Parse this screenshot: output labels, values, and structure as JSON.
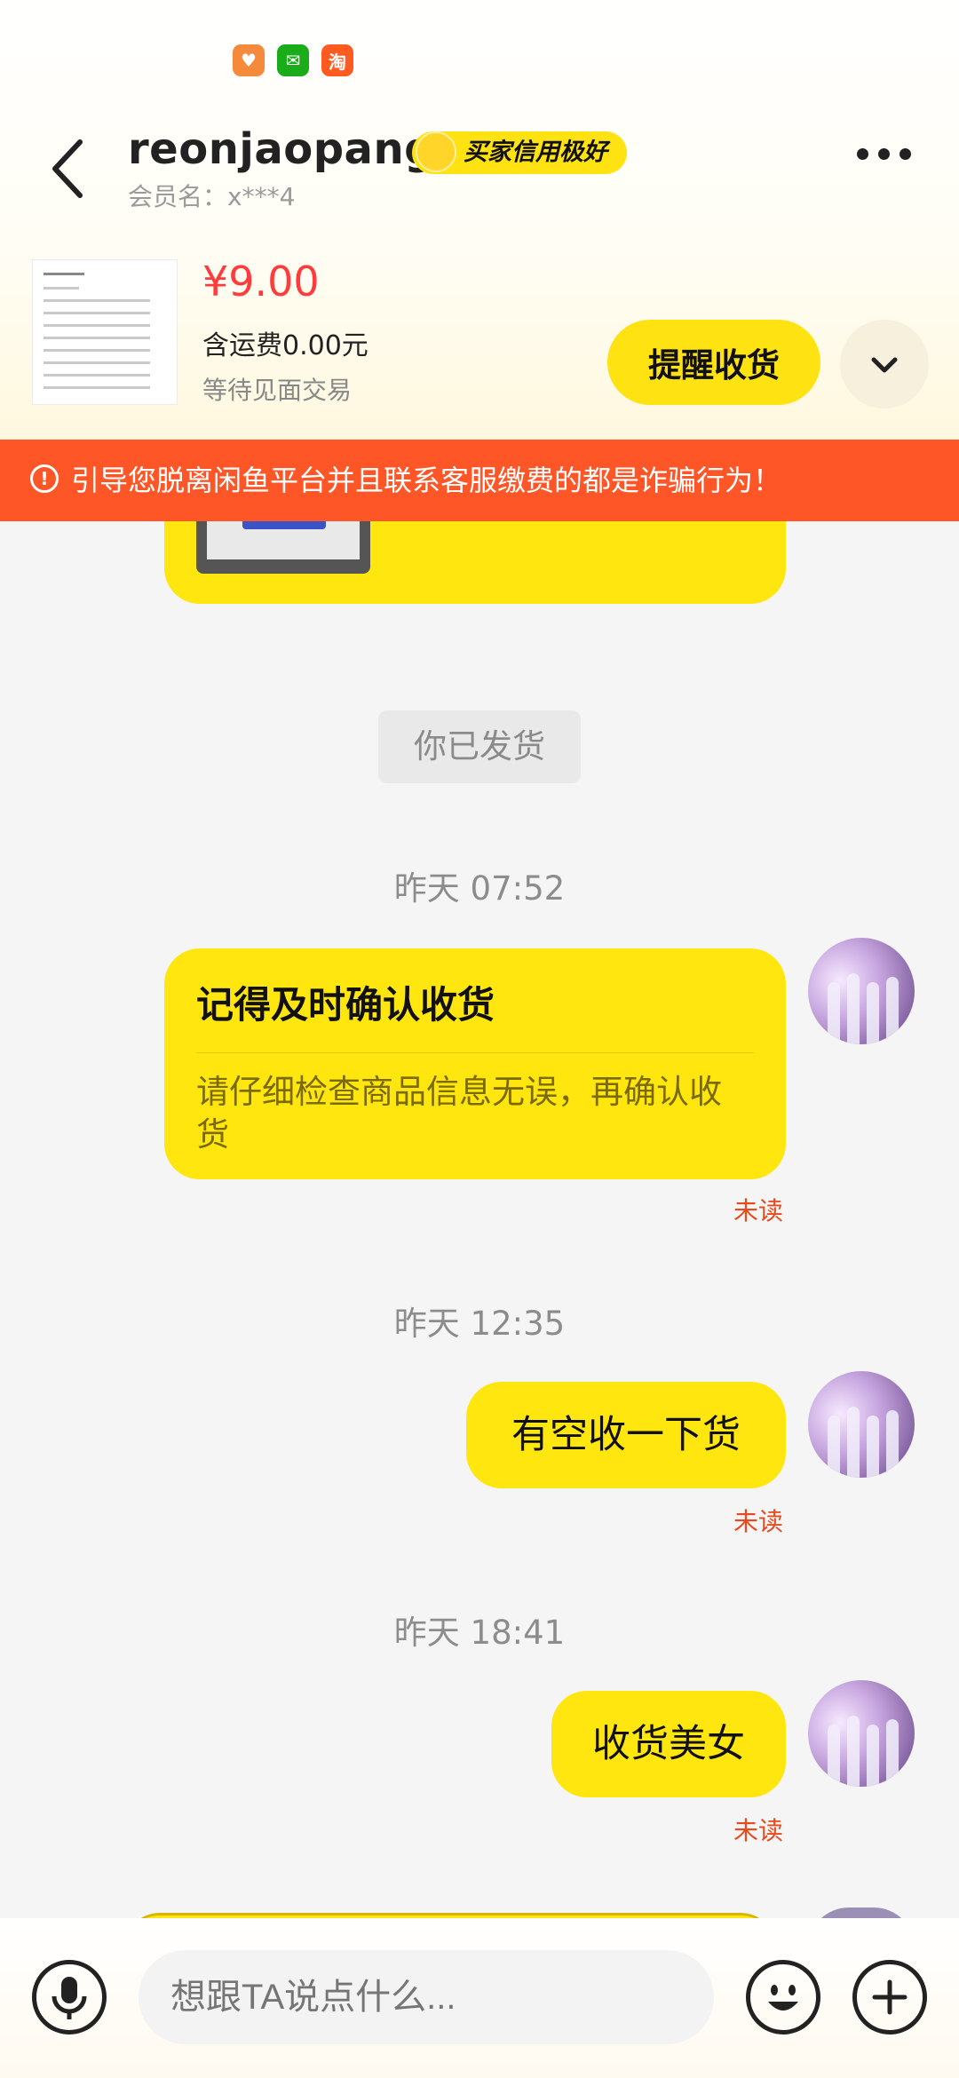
{
  "header": {
    "username": "reonjaopang",
    "credit_badge": "买家信用极好",
    "member_label": "会员名：x***4"
  },
  "status_bar": {
    "app_icons": [
      "health-icon",
      "wechat-icon",
      "taobao-icon"
    ]
  },
  "product": {
    "price": "¥9.00",
    "shipping": "含运费0.00元",
    "status": "等待见面交易",
    "remind_button": "提醒收货"
  },
  "warning": {
    "text": "引导您脱离闲鱼平台并且联系客服缴费的都是诈骗行为！"
  },
  "chat": {
    "system_notice": "你已发货",
    "messages": [
      {
        "timestamp": "昨天 07:52",
        "card_title": "记得及时确认收货",
        "card_body": "请仔细检查商品信息无误，再确认收货",
        "status": "未读"
      },
      {
        "timestamp": "昨天 12:35",
        "text": "有空收一下货",
        "status": "未读"
      },
      {
        "timestamp": "昨天 18:41",
        "text": "收货美女",
        "status": "未读"
      }
    ]
  },
  "input": {
    "placeholder": "想跟TA说点什么..."
  },
  "colors": {
    "accent_yellow": "#ffe60f",
    "warning_orange": "#ff5628",
    "price_red": "#ff3b3b",
    "unread_red": "#e84a1d"
  }
}
